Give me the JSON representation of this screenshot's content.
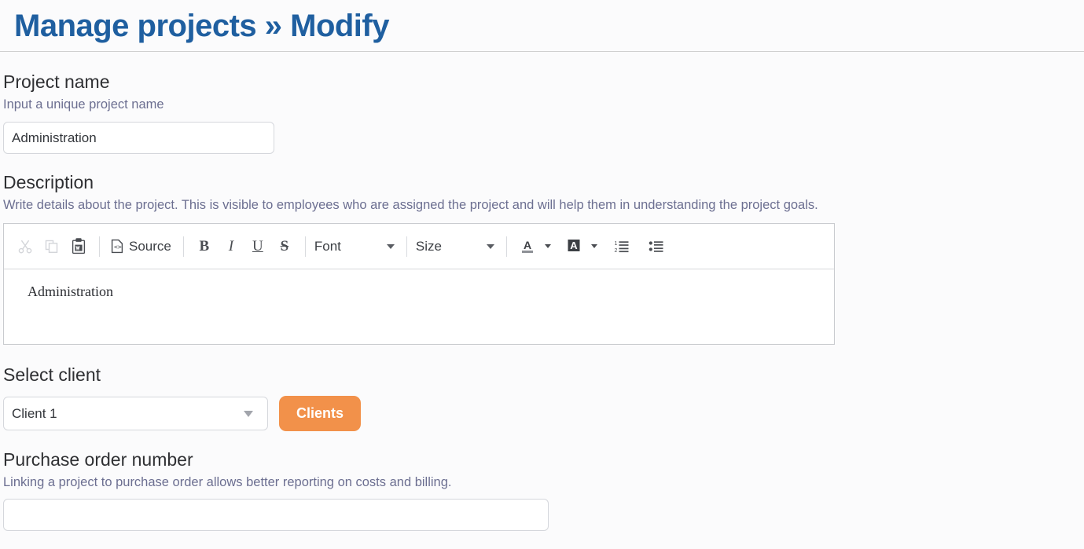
{
  "header": {
    "title": "Manage projects » Modify",
    "title_color": "#1f5fa0"
  },
  "form": {
    "project_name": {
      "label": "Project name",
      "help": "Input a unique project name",
      "value": "Administration",
      "placeholder": ""
    },
    "description": {
      "label": "Description",
      "help": "Write details about the project. This is visible to employees who are assigned the project and will help them in understanding the project goals.",
      "content": "Administration"
    },
    "select_client": {
      "label": "Select client",
      "selected": "Client 1",
      "button_label": "Clients",
      "button_color": "#f2914a"
    },
    "purchase_order": {
      "label": "Purchase order number",
      "help": "Linking a project to purchase order allows better reporting on costs and billing.",
      "value": "",
      "placeholder": ""
    }
  },
  "editor_toolbar": {
    "cut": "cut-icon",
    "copy": "copy-icon",
    "paste_from_word": "paste-from-word-icon",
    "source_label": "Source",
    "bold": "B",
    "italic": "I",
    "underline": "U",
    "strikethrough": "S",
    "font_label": "Font",
    "size_label": "Size",
    "text_color": "text-color-icon",
    "background_color": "background-color-icon",
    "numbered_list": "numbered-list-icon",
    "bulleted_list": "bulleted-list-icon"
  }
}
